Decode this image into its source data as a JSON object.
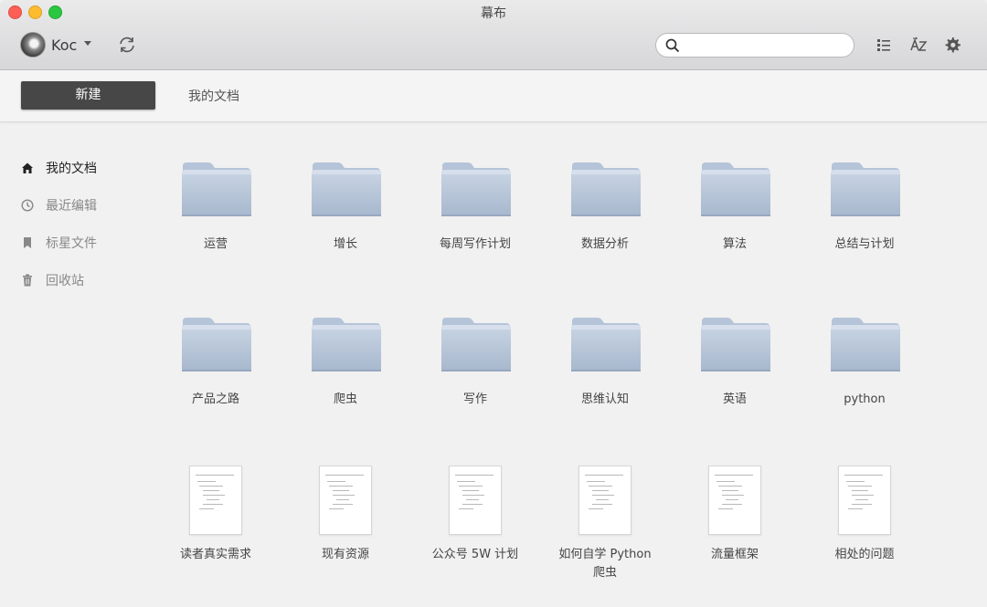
{
  "window": {
    "title": "幕布"
  },
  "toolbar": {
    "user_name": "Koc",
    "search_placeholder": "",
    "icons": [
      "sync-icon",
      "list-view-icon",
      "sort-az-icon",
      "gear-icon"
    ]
  },
  "actions": {
    "new_label": "新建",
    "breadcrumb": "我的文档"
  },
  "sidebar": {
    "items": [
      {
        "label": "我的文档",
        "icon": "home-icon",
        "active": true
      },
      {
        "label": "最近编辑",
        "icon": "clock-icon",
        "active": false
      },
      {
        "label": "标星文件",
        "icon": "bookmark-icon",
        "active": false
      },
      {
        "label": "回收站",
        "icon": "trash-icon",
        "active": false
      }
    ]
  },
  "folders": [
    "运营",
    "增长",
    "每周写作计划",
    "数据分析",
    "算法",
    "总结与计划",
    "产品之路",
    "爬虫",
    "写作",
    "思维认知",
    "英语",
    "python"
  ],
  "documents": [
    "读者真实需求",
    "现有资源",
    "公众号 5W 计划",
    "如何自学 Python 爬虫",
    "流量框架",
    "相处的问题"
  ],
  "colors": {
    "new_button": "#474747",
    "folder": "#b4c3d8",
    "active_text": "#222222",
    "inactive_text": "#888888"
  }
}
